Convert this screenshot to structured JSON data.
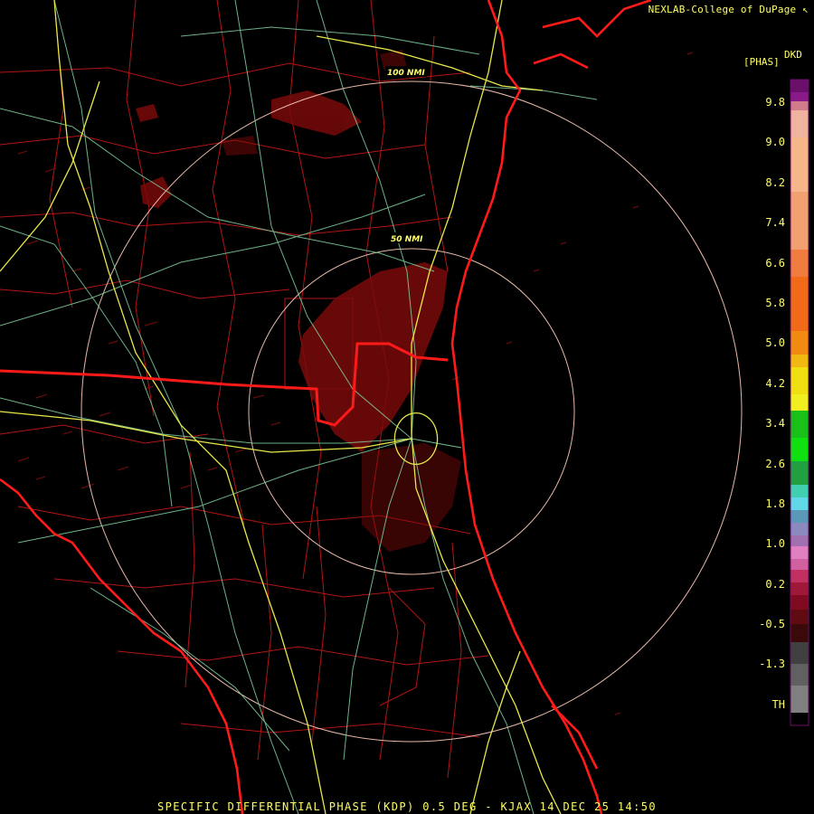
{
  "credit": "NEXLAB-College of DuPage",
  "credit_icon": "cursor-icon",
  "legend": {
    "units": "DKD",
    "title": "[PHAS]",
    "labels": [
      "9.8",
      "9.0",
      "8.2",
      "7.4",
      "6.6",
      "5.8",
      "5.0",
      "4.2",
      "3.4",
      "2.6",
      "1.8",
      "1.0",
      "0.2",
      "-0.5",
      "-1.3",
      "TH"
    ],
    "bottom_color": "#000000"
  },
  "rings": [
    "100 NMI",
    "50 NMI"
  ],
  "footer": "SPECIFIC DIFFERENTIAL PHASE (KDP) 0.5 DEG - KJAX 14 DEC 25 14:50",
  "colors": {
    "background": "#000000",
    "coastline": "#ff1a1a",
    "state_border": "#ff1a1a",
    "county_line": "#b31414",
    "highway": "#e8e84a",
    "road": "#7fd2a0",
    "ring": "#e8b7a8",
    "echo": "#7a0a0a",
    "text": "#ffff66"
  }
}
